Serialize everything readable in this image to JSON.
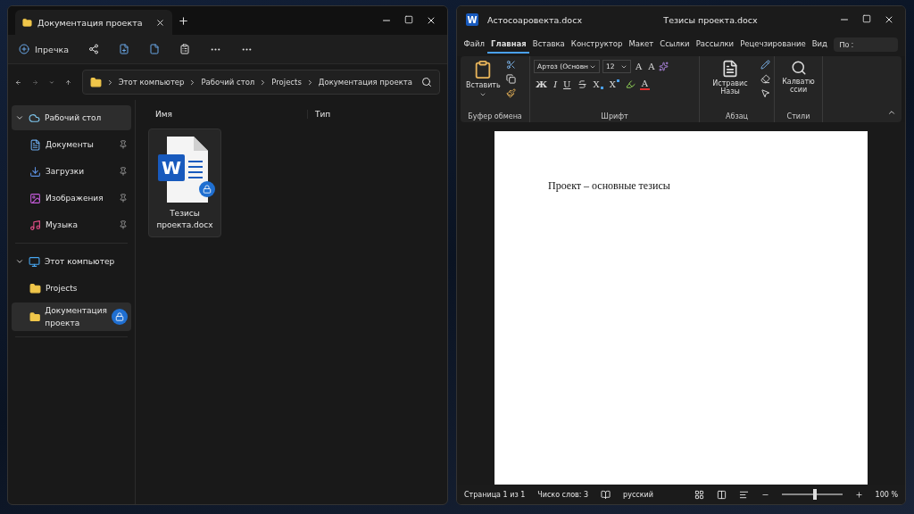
{
  "explorer": {
    "tab_title": "Документация проекта",
    "new_button": "Iпречка",
    "breadcrumbs": [
      "Этот компьютер",
      "Рабочий стол",
      "Projects",
      "Документация проекта"
    ],
    "columns": [
      "Имя",
      "Тип"
    ],
    "nav": [
      {
        "label": "Рабочий стол",
        "kind": "desktop",
        "expanded": true,
        "selected": true,
        "children": [
          {
            "label": "Документы",
            "kind": "documents",
            "pinned": true,
            "selected": false
          },
          {
            "label": "Загрузки",
            "kind": "downloads",
            "pinned": true,
            "selected": false
          },
          {
            "label": "Изображения",
            "kind": "pictures",
            "pinned": true,
            "selected": false
          },
          {
            "label": "Музыка",
            "kind": "music",
            "pinned": true,
            "selected": false
          }
        ]
      },
      {
        "label": "Этот компьютер",
        "kind": "computer",
        "expanded": true,
        "selected": false,
        "children": [
          {
            "label": "Projects",
            "kind": "folder",
            "selected": false
          },
          {
            "label": "Документация проекта",
            "kind": "folder",
            "selected": true,
            "locked": true
          }
        ]
      }
    ],
    "files": [
      {
        "name": "Тезисы проекта.docx",
        "icon_letter": "W",
        "locked": true,
        "selected": true
      }
    ]
  },
  "word": {
    "app_letter": "W",
    "file_name": "Астосоаровекта.docx",
    "title": "Тезисы проекта.docx",
    "tabs": [
      {
        "label": "Файл",
        "selected": false
      },
      {
        "label": "Главная",
        "selected": true
      },
      {
        "label": "Вставка",
        "selected": false
      },
      {
        "label": "Конструктор",
        "selected": false
      },
      {
        "label": "Макет",
        "selected": false
      },
      {
        "label": "Ссылки",
        "selected": false
      },
      {
        "label": "Рассылки",
        "selected": false
      },
      {
        "label": "Рецечзирование",
        "selected": false
      },
      {
        "label": "Вид",
        "selected": false
      }
    ],
    "search": "По :",
    "paste_label": "Вставить",
    "font_name": "Артоз (Основн",
    "font_size": "12",
    "grow_labels": [
      "A",
      "A"
    ],
    "format_buttons": [
      {
        "kind": "bold",
        "label": "Ж"
      },
      {
        "kind": "italic",
        "label": "I"
      },
      {
        "kind": "underline",
        "label": "U"
      },
      {
        "kind": "strike"
      },
      {
        "kind": "subscript",
        "label": "X"
      },
      {
        "kind": "superscript",
        "label": "X"
      },
      {
        "kind": "highlight"
      },
      {
        "kind": "color",
        "label": "A"
      }
    ],
    "styles_label": "Истравис Назы",
    "editing_label": "Калватю ссии",
    "groups": [
      "Буфер обмена",
      "Шрифт",
      "Абзац",
      "Стили"
    ],
    "document_text": "Проект – основные тезисы",
    "status": {
      "page": "Страница 1 из 1",
      "words": "Чиско слов: 3",
      "language": "русский",
      "zoom": "100 %",
      "level": 0.55
    }
  }
}
